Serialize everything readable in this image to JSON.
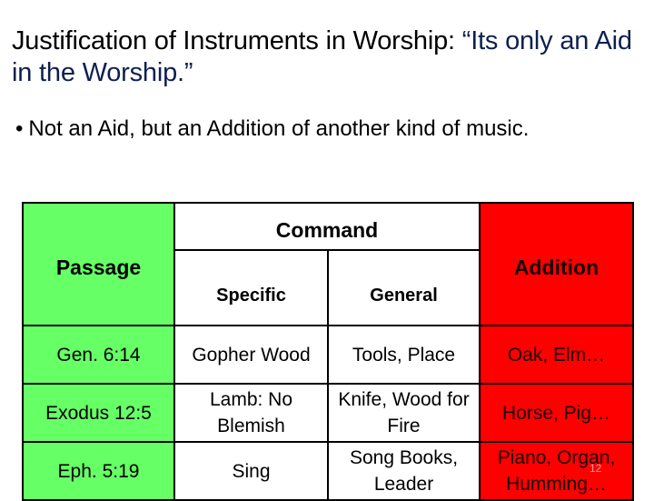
{
  "slide": {
    "title_part1": "Justification of Instruments in Worship: ",
    "title_part2": "“Its only an Aid in the Worship.”",
    "bullet_symbol": "•",
    "bullet_text": "Not an Aid, but an Addition of another kind of music.",
    "page_number": "12"
  },
  "table": {
    "headers": {
      "passage": "Passage",
      "command": "Command",
      "specific": "Specific",
      "general": "General",
      "addition": "Addition"
    },
    "rows": [
      {
        "passage": "Gen. 6:14",
        "specific": "Gopher Wood",
        "general": "Tools, Place",
        "addition": "Oak, Elm…"
      },
      {
        "passage": "Exodus 12:5",
        "specific": "Lamb: No Blemish",
        "general": "Knife, Wood for Fire",
        "addition": "Horse, Pig…"
      },
      {
        "passage": "Eph. 5:19",
        "specific": "Sing",
        "general": "Song Books, Leader",
        "addition": "Piano, Organ, Humming…"
      }
    ],
    "colors": {
      "passage_column": "#66ff66",
      "addition_column": "#ff0000",
      "command_columns": "#ffffff"
    }
  }
}
